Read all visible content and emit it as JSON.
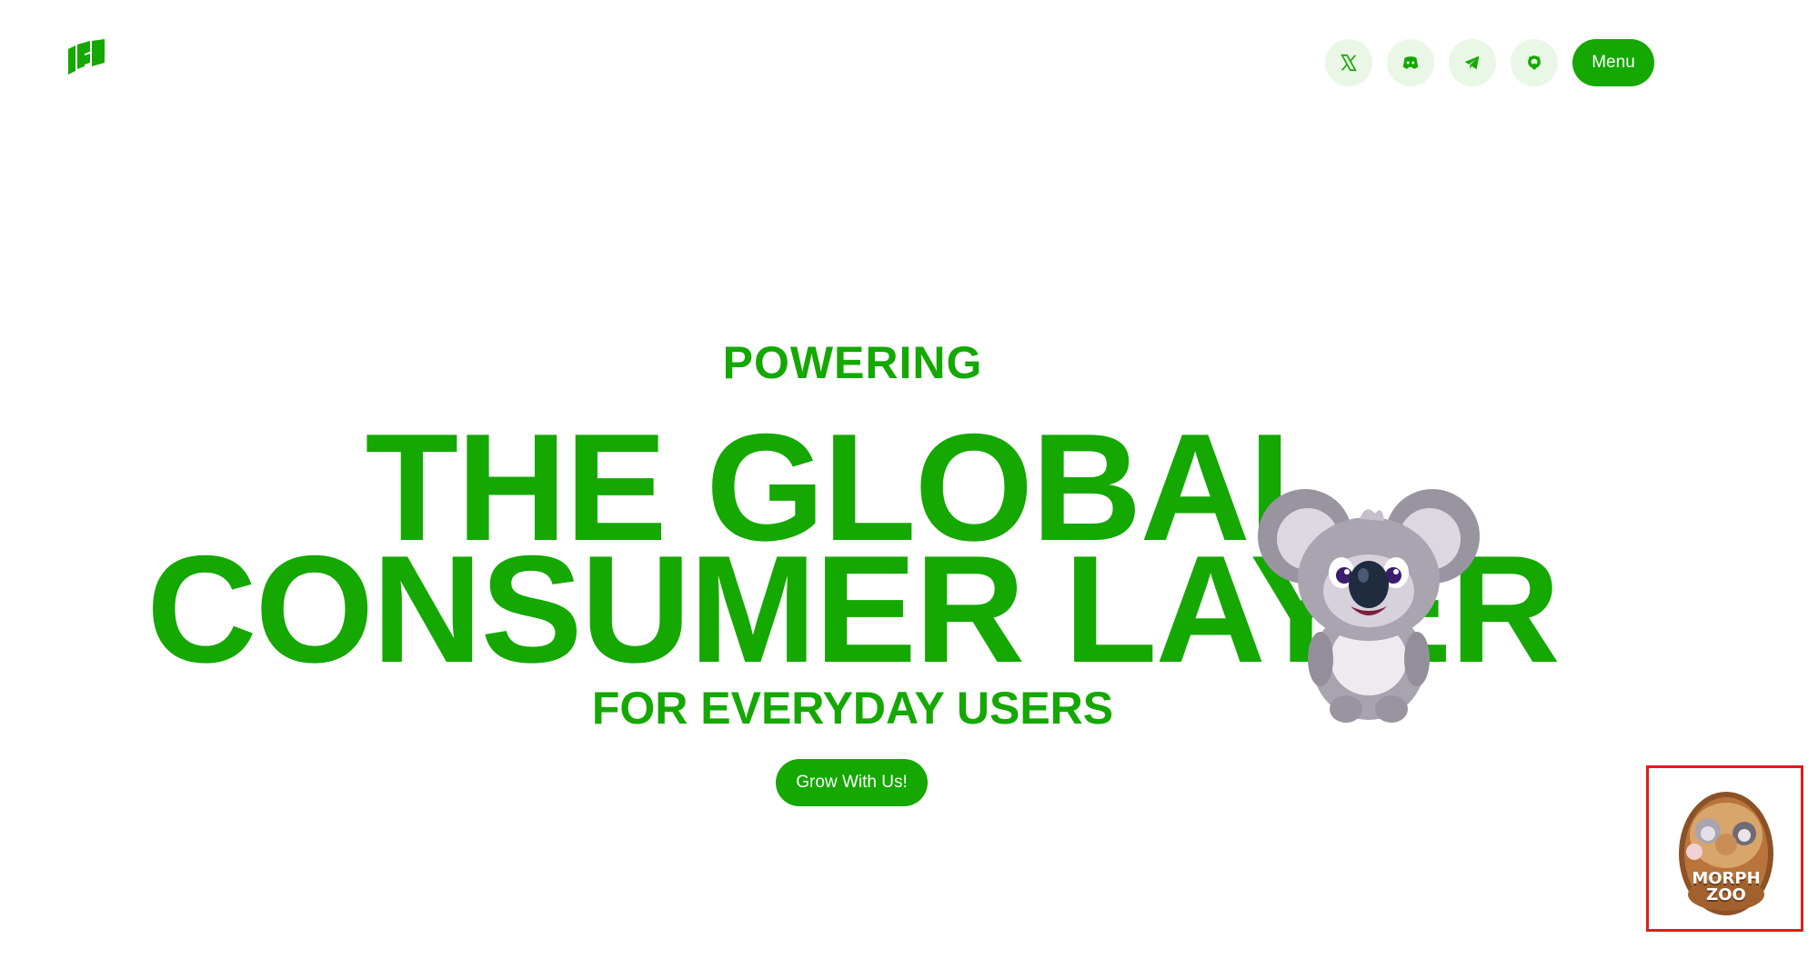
{
  "header": {
    "social": [
      {
        "name": "x",
        "icon": "x-icon"
      },
      {
        "name": "discord",
        "icon": "discord-icon"
      },
      {
        "name": "telegram",
        "icon": "telegram-icon"
      },
      {
        "name": "github",
        "icon": "github-icon"
      }
    ],
    "menu_label": "Menu"
  },
  "hero": {
    "eyebrow": "POWERING",
    "line1": "THE GLOBAL",
    "line2": "CONSUMER LAYER",
    "subtitle": "FOR EVERYDAY USERS",
    "cta_label": "Grow With Us!"
  },
  "badge": {
    "title_line1": "MORPH",
    "title_line2": "ZOO"
  },
  "colors": {
    "brand": "#14a800",
    "brand_light": "#eaf6e6",
    "highlight_frame": "#e21b1b"
  }
}
